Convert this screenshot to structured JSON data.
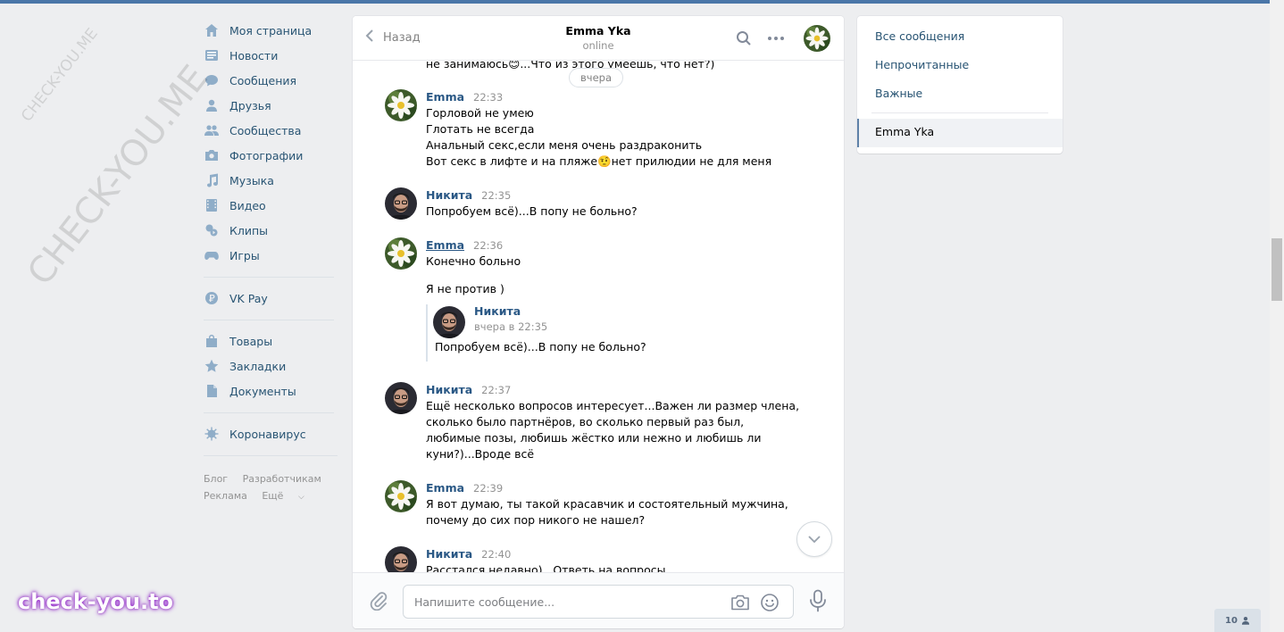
{
  "nav": {
    "items": [
      {
        "label": "Моя страница",
        "icon": "home-icon"
      },
      {
        "label": "Новости",
        "icon": "news-icon"
      },
      {
        "label": "Сообщения",
        "icon": "messages-icon"
      },
      {
        "label": "Друзья",
        "icon": "friends-icon"
      },
      {
        "label": "Сообщества",
        "icon": "communities-icon"
      },
      {
        "label": "Фотографии",
        "icon": "camera-icon"
      },
      {
        "label": "Музыка",
        "icon": "music-icon"
      },
      {
        "label": "Видео",
        "icon": "video-icon"
      },
      {
        "label": "Клипы",
        "icon": "clips-icon"
      },
      {
        "label": "Игры",
        "icon": "gamepad-icon"
      },
      {
        "label": "VK Pay",
        "icon": "vkpay-icon"
      },
      {
        "label": "Товары",
        "icon": "bag-icon"
      },
      {
        "label": "Закладки",
        "icon": "star-icon"
      },
      {
        "label": "Документы",
        "icon": "document-icon"
      },
      {
        "label": "Коронавирус",
        "icon": "virus-icon"
      }
    ],
    "footer": {
      "blog": "Блог",
      "dev": "Разработчикам",
      "ads": "Реклама",
      "more": "Ещё"
    }
  },
  "chat": {
    "back_label": "Назад",
    "peer_name": "Emma Yka",
    "peer_status": "online",
    "cut_text": "не занимаюсь😊...Что из этого умеешь, что нет?)",
    "date_pill": "вчера",
    "messages": [
      {
        "author": "Emma",
        "time": "22:33",
        "lines": [
          "Горловой не умею",
          "Глотать не всегда",
          "Анальный секс,если меня очень раздраконить",
          "Вот секс в лифте и на пляже🤨нет прилюдии не для меня"
        ]
      },
      {
        "author": "Никита",
        "time": "22:35",
        "lines": [
          "Попробуем всё)...В попу не больно?"
        ]
      },
      {
        "author": "Emma",
        "time": "22:36",
        "lines": [
          "Конечно больно",
          "Я не против )"
        ]
      },
      {
        "author": "Никита",
        "time": "22:37",
        "lines": [
          "Ещё несколько вопросов интересует...Важен ли размер члена,",
          "сколько было партнёров, во сколько первый раз был,",
          "любимые позы, любишь жёстко или нежно и любишь ли",
          "куни?)...Вроде всё"
        ]
      },
      {
        "author": "Emma",
        "time": "22:39",
        "lines": [
          "Я вот думаю, ты такой красавчик и состоятельный мужчина,",
          "почему до сих пор никого не нашел?"
        ]
      },
      {
        "author": "Никита",
        "time": "22:40",
        "lines": [
          "Расстался недавно)...Ответь на вопросы"
        ]
      }
    ],
    "forwarded": {
      "author": "Никита",
      "date": "вчера в 22:35",
      "text": "Попробуем всё)...В попу не больно?"
    },
    "composer": {
      "placeholder": "Напишите сообщение..."
    }
  },
  "filters": {
    "all": "Все сообщения",
    "unread": "Непрочитанные",
    "important": "Важные",
    "active": "Emma Yka"
  },
  "counter": "10",
  "watermark": {
    "logo": "check-you.to",
    "small": "CHECK-YOU.ME",
    "large": "CHECK-YOU.ME"
  },
  "colors": {
    "accent": "#4a76a8",
    "link": "#2a5885",
    "background": "#edeef0"
  }
}
